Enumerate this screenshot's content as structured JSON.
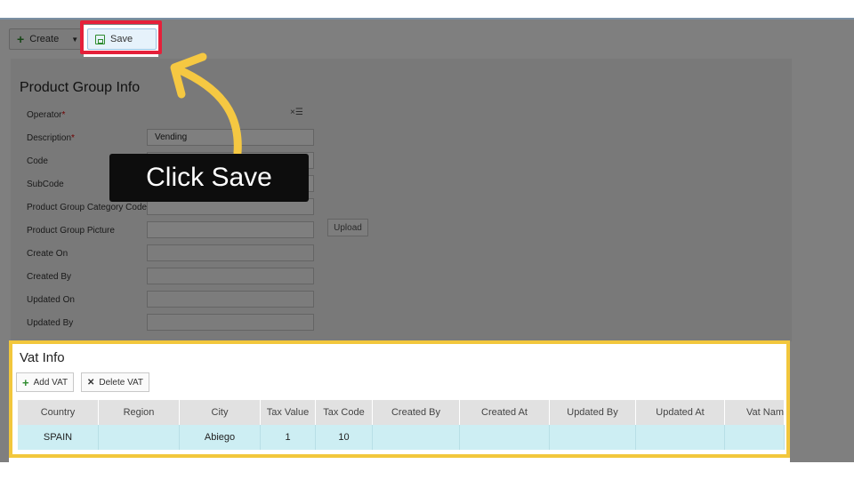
{
  "toolbar": {
    "create_label": "Create",
    "save_label": "Save"
  },
  "product_group": {
    "title": "Product Group Info",
    "fields": [
      {
        "label": "Operator",
        "required": true,
        "value": ""
      },
      {
        "label": "Description",
        "required": true,
        "value": "Vending"
      },
      {
        "label": "Code",
        "required": false,
        "value": ""
      },
      {
        "label": "SubCode",
        "required": false,
        "value": ""
      },
      {
        "label": "Product Group Category Code",
        "required": false,
        "value": ""
      },
      {
        "label": "Product Group Picture",
        "required": false,
        "value": ""
      },
      {
        "label": "Create On",
        "required": false,
        "value": ""
      },
      {
        "label": "Created By",
        "required": false,
        "value": ""
      },
      {
        "label": "Updated On",
        "required": false,
        "value": ""
      },
      {
        "label": "Updated By",
        "required": false,
        "value": ""
      }
    ],
    "operator_clear": "×☰",
    "upload_label": "Upload"
  },
  "vat_info": {
    "title": "Vat Info",
    "add_label": "Add VAT",
    "delete_label": "Delete VAT",
    "columns": [
      "Country",
      "Region",
      "City",
      "Tax Value",
      "Tax Code",
      "Created By",
      "Created At",
      "Updated By",
      "Updated At",
      "Vat Nam"
    ],
    "rows": [
      [
        "SPAIN",
        "",
        "Abiego",
        "1",
        "10",
        "",
        "",
        "",
        "",
        ""
      ]
    ]
  },
  "tutorial": {
    "callout_text": "Click Save"
  },
  "colors": {
    "save_highlight": "#e5203a",
    "vat_highlight": "#f2c73c",
    "arrow": "#f5c842",
    "selected_row": "#cdeef3"
  }
}
